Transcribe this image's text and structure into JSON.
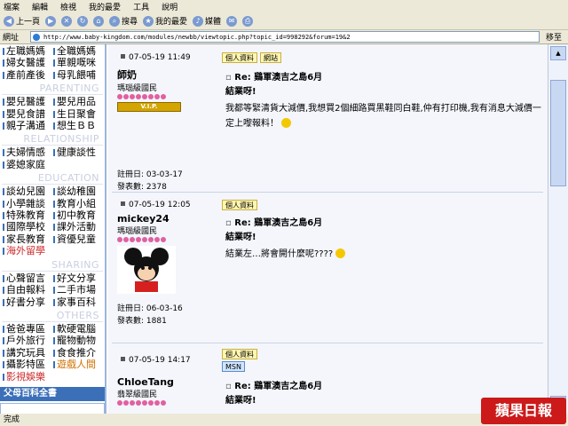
{
  "menu": [
    "檔案",
    "編輯",
    "檢視",
    "我的最愛",
    "工具",
    "說明"
  ],
  "toolbar": {
    "back": "上一頁",
    "search": "搜尋",
    "favorites": "我的最愛",
    "media": "媒體"
  },
  "address": {
    "label": "網址",
    "url": "http://www.baby-kingdom.com/modules/newbb/viewtopic.php?topic_id=998292&forum=19&2",
    "go": "移至"
  },
  "sidebar": {
    "top": [
      [
        "左職媽媽",
        "全職媽媽"
      ],
      [
        "婦女醫護",
        "單親嘅咪"
      ],
      [
        "產前產後",
        "母乳餵哺"
      ]
    ],
    "parenting_head": "PARENTING",
    "parenting": [
      [
        "嬰兒醫護",
        "嬰兒用品"
      ],
      [
        "嬰兒食譜",
        "生日聚會"
      ],
      [
        "親子溝通",
        "想生ＢＢ"
      ]
    ],
    "relationship_head": "RELATIONSHIP",
    "relationship": [
      [
        "夫婦情感",
        "健康談性"
      ],
      [
        "婆媳家庭",
        ""
      ]
    ],
    "education_head": "EDUCATION",
    "education": [
      [
        "談幼兒園",
        "談幼稚園"
      ],
      [
        "小學雜談",
        "教育小組"
      ],
      [
        "特殊教育",
        "初中教育"
      ],
      [
        "國際學校",
        "課外活動"
      ],
      [
        "家長教育",
        "資優兒童"
      ],
      [
        "海外留學",
        ""
      ]
    ],
    "sharing_head": "SHARING",
    "sharing": [
      [
        "心聲留言",
        "好文分享"
      ],
      [
        "自由報料",
        "二手市場"
      ],
      [
        "好書分享",
        "家事百科"
      ]
    ],
    "others_head": "OTHERS",
    "others": [
      [
        "爸爸專區",
        "軟硬電腦"
      ],
      [
        "戶外旅行",
        "寵物動物"
      ],
      [
        "講究玩具",
        "食食推介"
      ],
      [
        "攝影特區",
        "遊戲人間"
      ],
      [
        "影視娛樂",
        ""
      ]
    ],
    "banner": "父母百科全書"
  },
  "posts": [
    {
      "date": "07-05-19 11:49",
      "tags": [
        "個人資料",
        "網站"
      ],
      "user": "師奶",
      "rank": "瑪瑙級國民",
      "vip": "V.I.P.",
      "reg_label": "註冊日:",
      "reg": "03-03-17",
      "count_label": "發表數:",
      "count": "2378",
      "subject": "Re: 鷄軍澳吉之島6月",
      "re": "結業呀!",
      "text": "我都等緊清貨大減價,我想買2個細路買黑鞋同白鞋,仲有打印機,我有消息大減價一定上嚟報料！"
    },
    {
      "date": "07-05-19 12:05",
      "tags": [
        "個人資料"
      ],
      "user": "mickey24",
      "rank": "瑪瑙級國民",
      "reg_label": "註冊日:",
      "reg": "06-03-16",
      "count_label": "發表數:",
      "count": "1881",
      "subject": "Re: 鷄軍澳吉之島6月",
      "re": "結業呀!",
      "text": "結業左…將會開什麼呢????"
    },
    {
      "date": "07-05-19 14:17",
      "tags": [
        "個人資料",
        "MSN"
      ],
      "user": "ChloeTang",
      "rank": "翡翠級國民",
      "subject": "Re: 鷄軍澳吉之島6月",
      "re": "結業呀!"
    }
  ],
  "status": "完成",
  "logo": "蘋果日報",
  "colors": {
    "accent": "#3b6fb8",
    "highlight": "#cc2a2a"
  }
}
